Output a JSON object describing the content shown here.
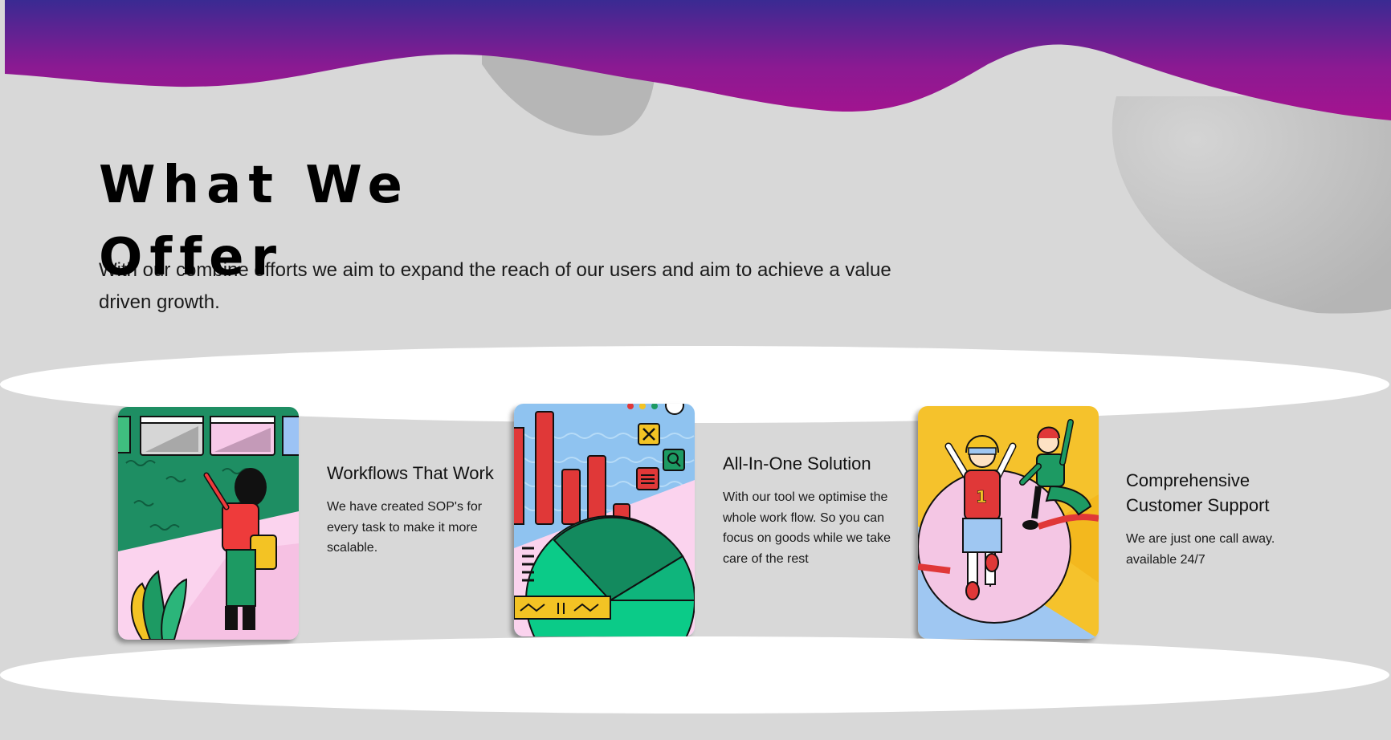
{
  "section": {
    "title": "What We Offer",
    "subtitle": "With our combine efforts we aim to expand the reach of our users and aim to achieve a value driven growth."
  },
  "services": [
    {
      "title": "Workflows That Work",
      "description": "We have created SOP's for every task to make it more scalable.",
      "illustration": "workflow-illustration"
    },
    {
      "title": "All-In-One Solution",
      "description": "With our tool we optimise the whole work flow. So you can focus on goods while we take care of the rest",
      "illustration": "analytics-illustration"
    },
    {
      "title": "Comprehensive Customer Support",
      "description": "We are just one call away. available 24/7",
      "illustration": "support-illustration"
    }
  ],
  "colors": {
    "banner_top": "#3a2a92",
    "banner_bottom": "#a0178f",
    "background": "#d8d8d8",
    "ellipse": "#ffffff"
  }
}
